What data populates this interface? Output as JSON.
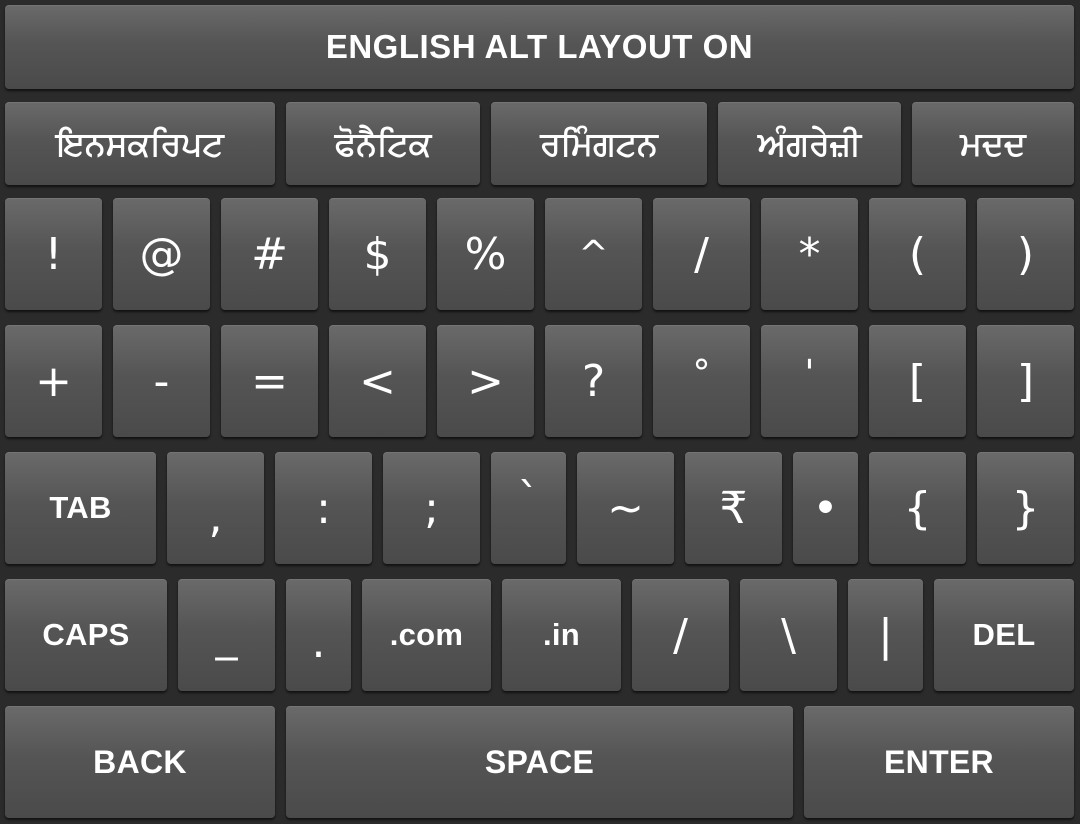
{
  "banner": {
    "label": "ENGLISH ALT LAYOUT ON"
  },
  "languages": {
    "inscript": "ਇਨਸਕਰਿਪਟ",
    "phonetic": "ਫੋਨੈਟਿਕ",
    "remington": "ਰਮਿੰਗਟਨ",
    "english": "ਅੰਗਰੇਜ਼ੀ",
    "help": "ਮਦਦ"
  },
  "row1": [
    "!",
    "@",
    "#",
    "$",
    "%",
    "^",
    "/",
    "*",
    "(",
    ")"
  ],
  "row2": [
    "+",
    "-",
    "=",
    "<",
    ">",
    "?",
    "°",
    "'",
    "[",
    "]"
  ],
  "row3": {
    "tab": "TAB",
    "keys": [
      ",",
      ":",
      ";",
      "`",
      "~",
      "₹",
      "•",
      "{",
      "}"
    ]
  },
  "row4": {
    "caps": "CAPS",
    "underscore": "_",
    "dot": ".",
    "dotcom": ".com",
    "dotin": ".in",
    "slash": "/",
    "backslash": "\\",
    "pipe": "|",
    "del": "DEL"
  },
  "row5": {
    "back": "BACK",
    "space": "SPACE",
    "enter": "ENTER"
  }
}
